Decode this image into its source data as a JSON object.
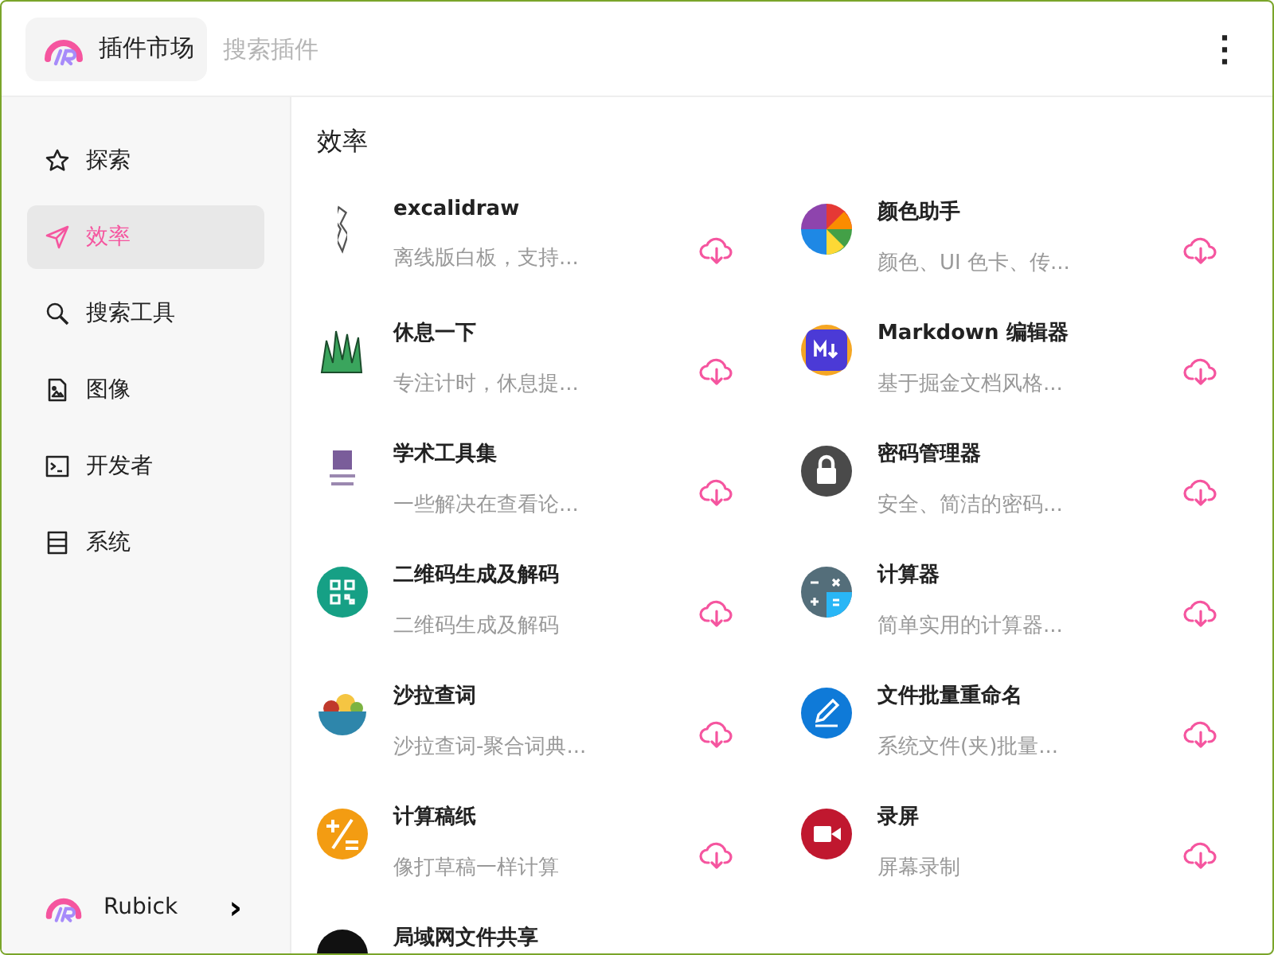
{
  "header": {
    "app_title": "插件市场",
    "search": {
      "placeholder": "搜索插件"
    },
    "menu": "⋮"
  },
  "sidebar": {
    "items": [
      {
        "label": "探索",
        "selected": false
      },
      {
        "label": "效率",
        "selected": true
      },
      {
        "label": "搜索工具",
        "selected": false
      },
      {
        "label": "图像",
        "selected": false
      },
      {
        "label": "开发者",
        "selected": false
      },
      {
        "label": "系统",
        "selected": false
      }
    ],
    "footer": {
      "label": "Rubick",
      "chevron": "›"
    }
  },
  "content": {
    "title": "效率",
    "plugins": [
      {
        "name": "excalidraw",
        "description": "离线版白板，支持..."
      },
      {
        "name": "颜色助手",
        "description": "颜色、UI 色卡、传..."
      },
      {
        "name": "休息一下",
        "description": "专注计时，休息提..."
      },
      {
        "name": "Markdown 编辑器",
        "description": "基于掘金文档风格..."
      },
      {
        "name": "学术工具集",
        "description": "一些解决在查看论..."
      },
      {
        "name": "密码管理器",
        "description": "安全、简洁的密码..."
      },
      {
        "name": "二维码生成及解码",
        "description": "二维码生成及解码"
      },
      {
        "name": "计算器",
        "description": "简单实用的计算器..."
      },
      {
        "name": "沙拉查词",
        "description": "沙拉查词-聚合词典..."
      },
      {
        "name": "文件批量重命名",
        "description": "系统文件(夹)批量..."
      },
      {
        "name": "计算稿纸",
        "description": "像打草稿一样计算"
      },
      {
        "name": "录屏",
        "description": "屏幕录制"
      },
      {
        "name": "局域网文件共享"
      }
    ]
  }
}
